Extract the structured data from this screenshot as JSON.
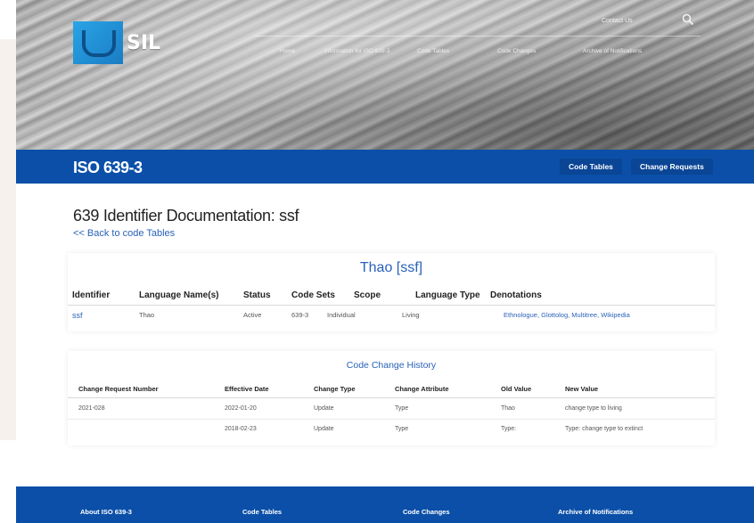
{
  "logo": {
    "text": "SIL"
  },
  "topnav": {
    "contact": "Contact Us",
    "items": [
      "Home",
      "Information for ISO 639-3",
      "Code Tables",
      "Code Changes",
      "Archive of Notifications"
    ]
  },
  "band": {
    "title": "ISO 639-3",
    "buttons": [
      "Code Tables",
      "Change Requests"
    ]
  },
  "doc": {
    "title": "639 Identifier Documentation: ssf",
    "back_link": "<< Back to code Tables"
  },
  "language": {
    "heading": "Thao [ssf]",
    "columns": [
      "Identifier",
      "Language Name(s)",
      "Status",
      "Code Sets",
      "Scope",
      "Language Type",
      "Denotations"
    ],
    "row": {
      "identifier": "ssf",
      "name": "Thao",
      "status": "Active",
      "code_sets": "639-3",
      "scope": "Individual",
      "type": "Living",
      "denotations": "Ethnologue, Glottolog, Multitree, Wikipedia"
    }
  },
  "history": {
    "heading": "Code Change History",
    "columns": [
      "Change Request Number",
      "Effective Date",
      "Change Type",
      "Change Attribute",
      "Old Value",
      "New Value"
    ],
    "rows": [
      {
        "number": "2021-028",
        "date": "2022-01-20",
        "change_type": "Update",
        "attribute": "Type",
        "old": "Thao",
        "new": "change type to living"
      },
      {
        "number": "",
        "date": "2018-02-23",
        "change_type": "Update",
        "attribute": "Type",
        "old": "Type:",
        "new": "Type: change type to extinct"
      }
    ]
  },
  "footer": {
    "items": [
      "About ISO 639-3",
      "Code Tables",
      "Code Changes",
      "Archive of Notifications"
    ]
  }
}
